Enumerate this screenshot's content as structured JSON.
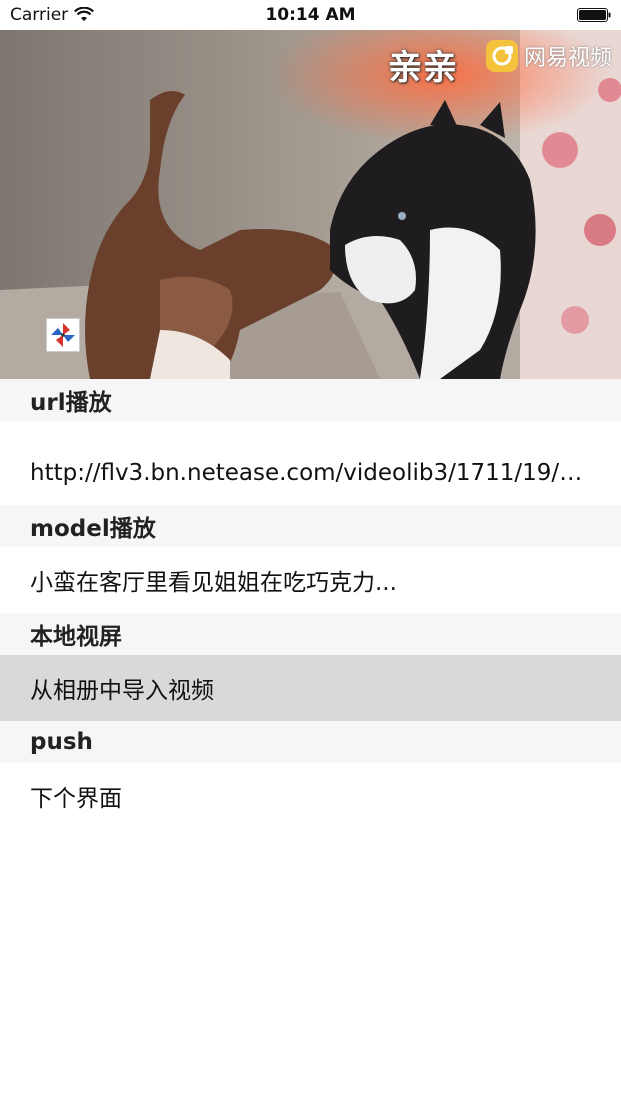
{
  "status_bar": {
    "carrier": "Carrier",
    "time": "10:14 AM"
  },
  "video": {
    "caption": "亲亲",
    "logo_text": "网易视频"
  },
  "table": {
    "sections": [
      {
        "header": "url播放",
        "rows": [
          "http://flv3.bn.netease.com/videolib3/1711/19/tj..."
        ]
      },
      {
        "header": "model播放",
        "rows": [
          "小蛮在客厅里看见姐姐在吃巧克力..."
        ]
      },
      {
        "header": "本地视屏",
        "rows": [
          "从相册中导入视频"
        ]
      },
      {
        "header": "push",
        "rows": [
          "下个界面"
        ]
      }
    ]
  }
}
